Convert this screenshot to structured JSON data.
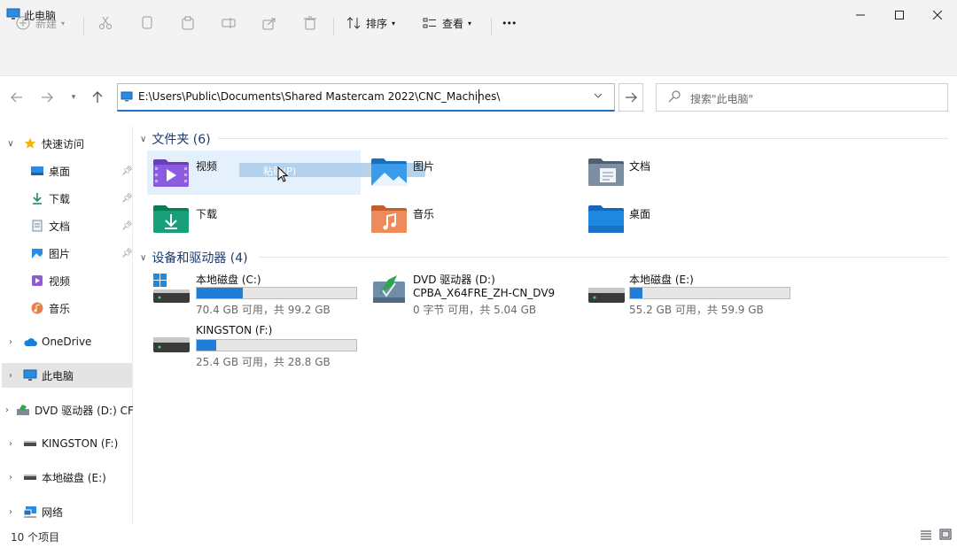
{
  "window": {
    "title": "此电脑"
  },
  "toolbar": {
    "new_label": "新建",
    "sort_label": "排序",
    "view_label": "查看",
    "more": "•••"
  },
  "address": {
    "path": "E:\\Users\\Public\\Documents\\Shared Mastercam 2022\\CNC_Machines\\",
    "search_placeholder": "搜索\"此电脑\""
  },
  "sidebar": {
    "quick_access": "快速访问",
    "items": [
      {
        "label": "桌面"
      },
      {
        "label": "下载"
      },
      {
        "label": "文档"
      },
      {
        "label": "图片"
      },
      {
        "label": "视频"
      },
      {
        "label": "音乐"
      }
    ],
    "onedrive": "OneDrive",
    "this_pc": "此电脑",
    "dvd": "DVD 驱动器 (D:) CF",
    "kingston": "KINGSTON (F:)",
    "local_e": "本地磁盘 (E:)",
    "network": "网络"
  },
  "main": {
    "folders_header": "文件夹 (6)",
    "folders": [
      {
        "label": "视频"
      },
      {
        "label": "图片"
      },
      {
        "label": "文档"
      },
      {
        "label": "下载"
      },
      {
        "label": "音乐"
      },
      {
        "label": "桌面"
      }
    ],
    "paste_tooltip": "粘贴(P)",
    "devices_header": "设备和驱动器 (4)",
    "drives": [
      {
        "name": "本地磁盘 (C:)",
        "info": "70.4 GB 可用，共 99.2 GB",
        "used_fraction": 0.29
      },
      {
        "name": "DVD 驱动器 (D:)",
        "label2": "CPBA_X64FRE_ZH-CN_DV9",
        "info": "0 字节 可用，共 5.04 GB"
      },
      {
        "name": "本地磁盘 (E:)",
        "info": "55.2 GB 可用，共 59.9 GB",
        "used_fraction": 0.08
      },
      {
        "name": "KINGSTON (F:)",
        "info": "25.4 GB 可用，共 28.8 GB",
        "used_fraction": 0.12
      }
    ]
  },
  "status": {
    "items": "10 个项目"
  },
  "colors": {
    "accent": "#1f7fd8",
    "selection": "#e4e4e4"
  }
}
